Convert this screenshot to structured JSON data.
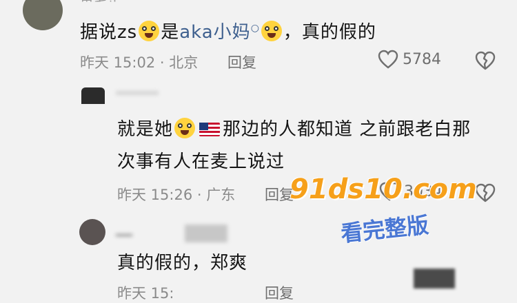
{
  "comments": [
    {
      "username": "鬼毛正",
      "text_parts": [
        "据说zs",
        "是",
        "aka小妈",
        "，真的假的"
      ],
      "time_location": "昨天 15:02 · 北京",
      "reply_label": "回复",
      "like_count": "5784"
    },
    {
      "text_line1_parts": [
        "就是她",
        "那边的人都知道 之前跟老白那"
      ],
      "text_line2": "次事有人在麦上说过",
      "time_location": "昨天 15:26 · 广东",
      "reply_label": "回复",
      "like_count": "3034"
    },
    {
      "text": "真的假的，郑爽",
      "time_location": "昨天 15:",
      "reply_label": "回复"
    }
  ],
  "watermark": {
    "site": "91ds10.com",
    "tagline": "看完整版"
  },
  "colors": {
    "background": "#f2f2f2",
    "text": "#141414",
    "meta": "#8a8a8a",
    "link": "#3d5f8e",
    "watermark_orange": "#f6a01a",
    "watermark_blue": "#4a77d4"
  },
  "icons": [
    "heart-outline-icon",
    "heart-broken-icon",
    "search-link-icon"
  ]
}
